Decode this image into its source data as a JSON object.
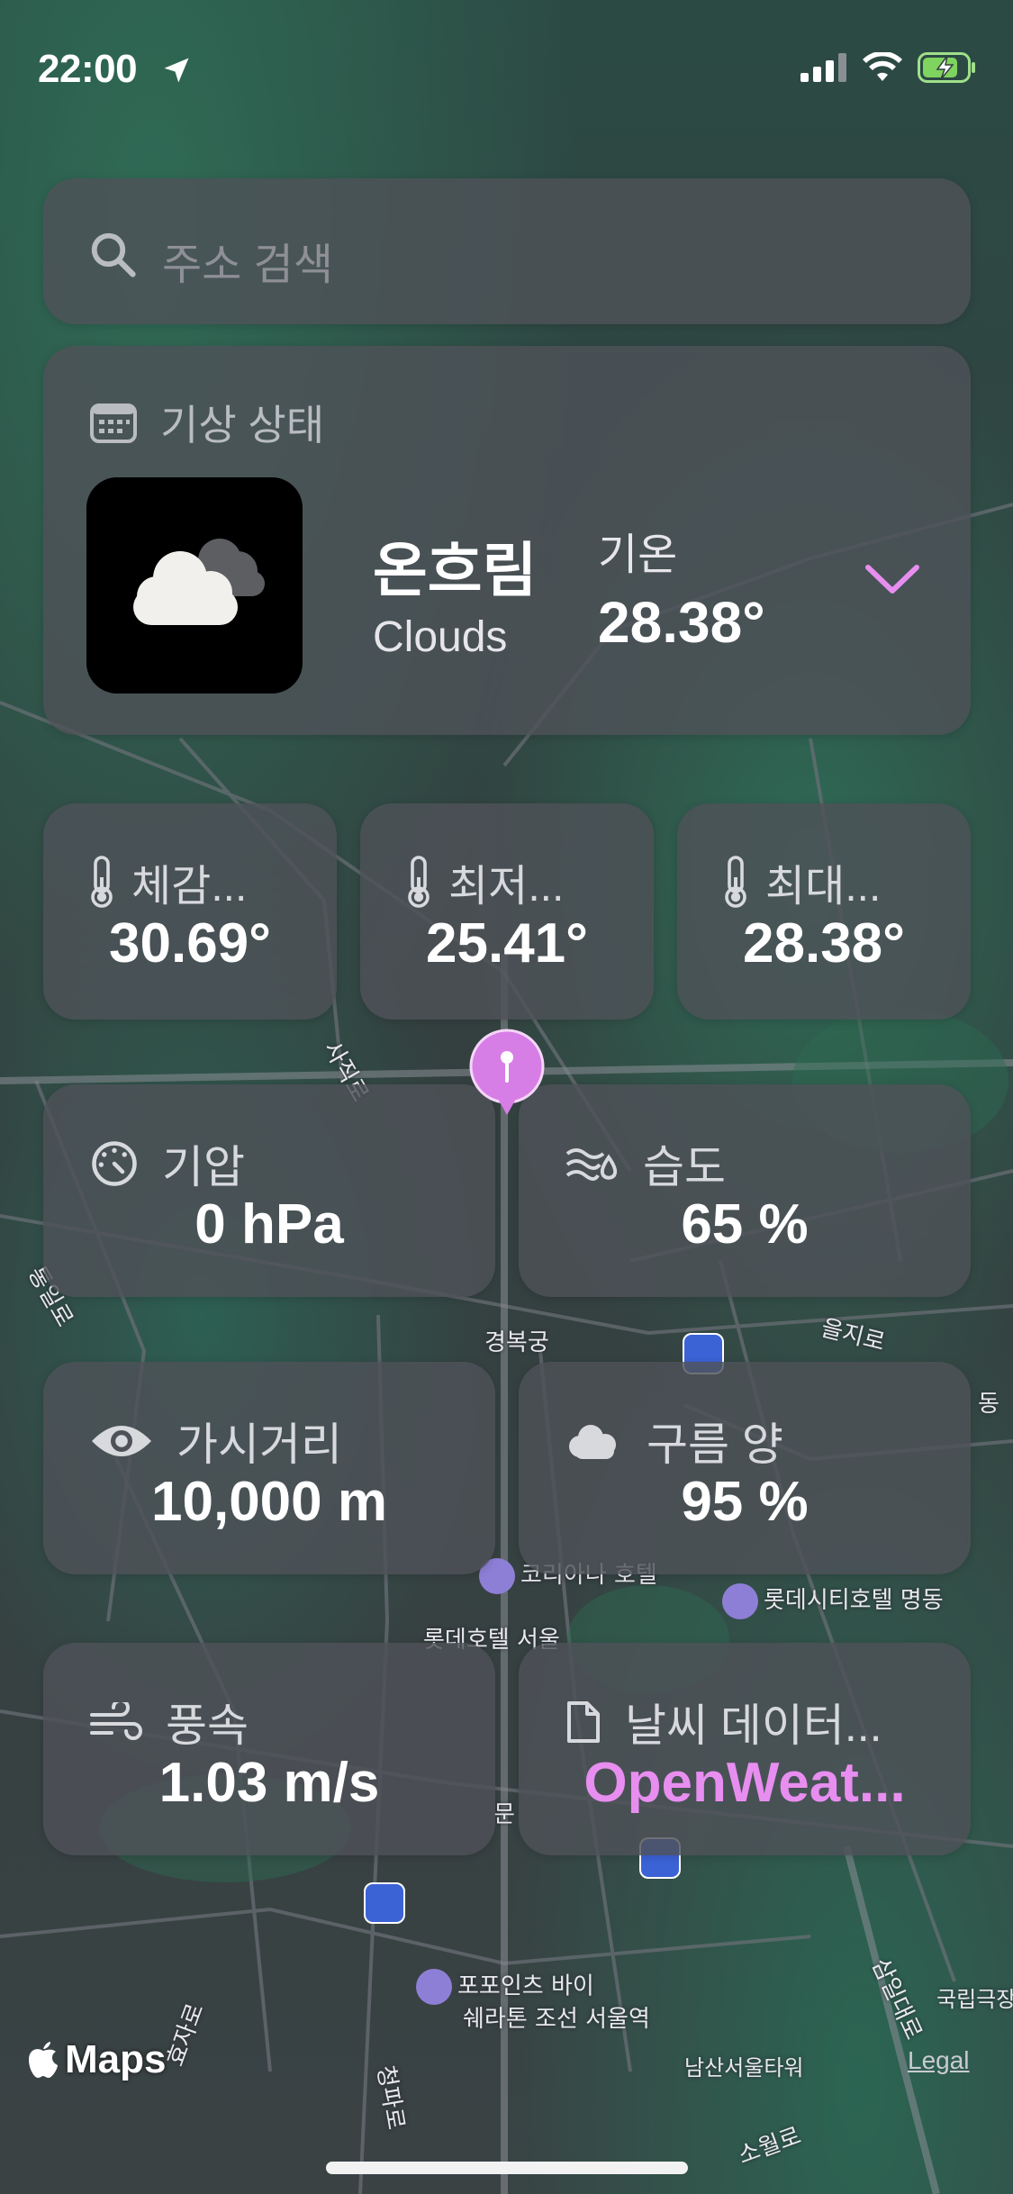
{
  "status_bar": {
    "time": "22:00"
  },
  "search": {
    "placeholder": "주소 검색",
    "icon": "search-icon"
  },
  "weather": {
    "header": "기상 상태",
    "condition_ko": "온흐림",
    "condition_en": "Clouds",
    "temp_label": "기온",
    "temp_value": "28.38°"
  },
  "stats_small": [
    {
      "label": "체감...",
      "value": "30.69°",
      "icon": "thermometer-icon"
    },
    {
      "label": "최저...",
      "value": "25.41°",
      "icon": "thermometer-icon"
    },
    {
      "label": "최대...",
      "value": "28.38°",
      "icon": "thermometer-icon"
    }
  ],
  "stats": [
    {
      "label": "기압",
      "value": "0 hPa",
      "icon": "gauge-icon"
    },
    {
      "label": "습도",
      "value": "65 %",
      "icon": "humidity-icon"
    },
    {
      "label": "가시거리",
      "value": "10,000 m",
      "icon": "eye-icon"
    },
    {
      "label": "구름 양",
      "value": "95 %",
      "icon": "cloud-icon"
    },
    {
      "label": "풍속",
      "value": "1.03 m/s",
      "icon": "wind-icon"
    },
    {
      "label": "날씨 데이터...",
      "value": "OpenWeat...",
      "icon": "document-icon"
    }
  ],
  "map": {
    "labels": {
      "gyeongbokgung": "경복궁",
      "lotte_city": "롯데시티호텔 명동",
      "four_points": "포포인츠 바이",
      "sheraton": "쉐라톤 조선 서울역",
      "namsan": "남산서울타워",
      "theater": "국립극장",
      "eulji": "을지로",
      "lotte_seoul": "롯데호텔 서울",
      "hotel_frag": "코리아나 호텔",
      "road_sajik": "사직로",
      "road_cheongpa": "청파로",
      "road_somwol": "소월로",
      "road_samil": "삼일대로",
      "road_tongil": "통일로",
      "road_hyoja": "효자로",
      "frag_dong": "동",
      "frag_mun": "문"
    },
    "brand": "Maps",
    "legal": "Legal"
  },
  "colors": {
    "accent": "#e88ef0",
    "card": "#4e5258"
  }
}
